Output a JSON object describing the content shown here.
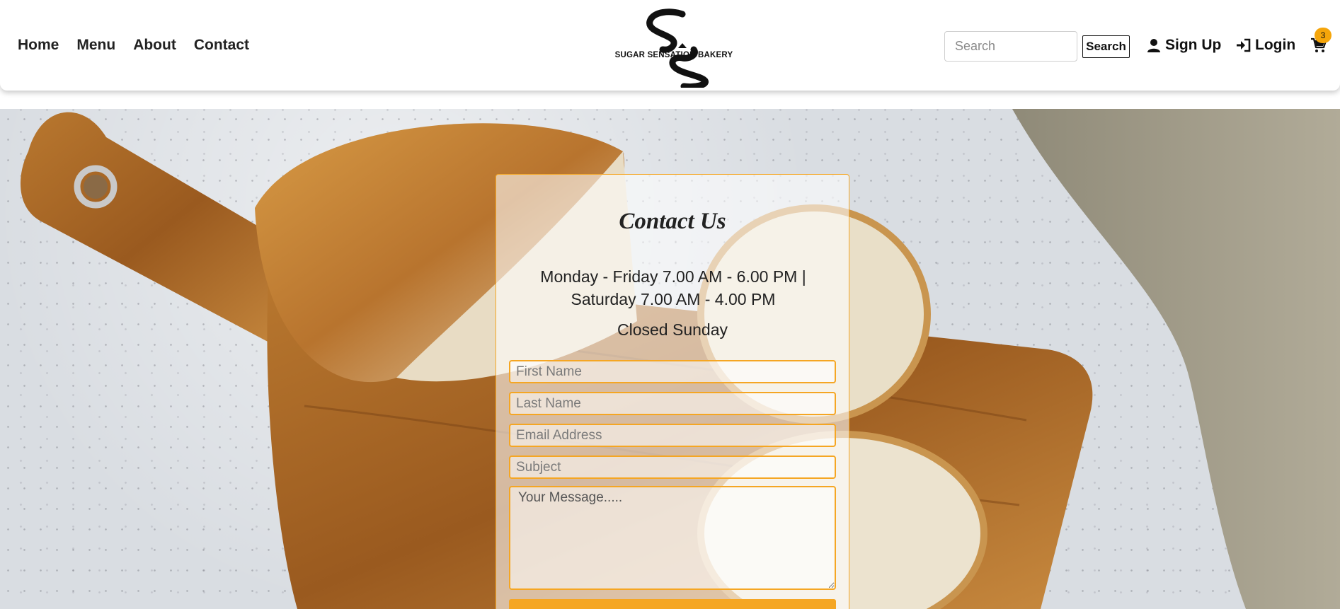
{
  "nav": {
    "home": "Home",
    "menu": "Menu",
    "about": "About",
    "contact": "Contact"
  },
  "brand": {
    "logo_text": "SUGAR SENSATION BAKERY"
  },
  "search": {
    "placeholder": "Search",
    "button_label": "Search"
  },
  "account": {
    "signup_label": "Sign Up",
    "login_label": "Login"
  },
  "cart": {
    "count": "3"
  },
  "contact": {
    "title": "Contact Us",
    "hours": "Monday - Friday 7.00 AM - 6.00 PM | Saturday 7.00 AM - 4.00 PM",
    "closed": "Closed Sunday",
    "first_name_placeholder": "First Name",
    "last_name_placeholder": "Last Name",
    "email_placeholder": "Email Address",
    "subject_placeholder": "Subject",
    "message_placeholder": "Your Message....."
  },
  "colors": {
    "accent": "#f5a623",
    "badge": "#f5a50a"
  }
}
